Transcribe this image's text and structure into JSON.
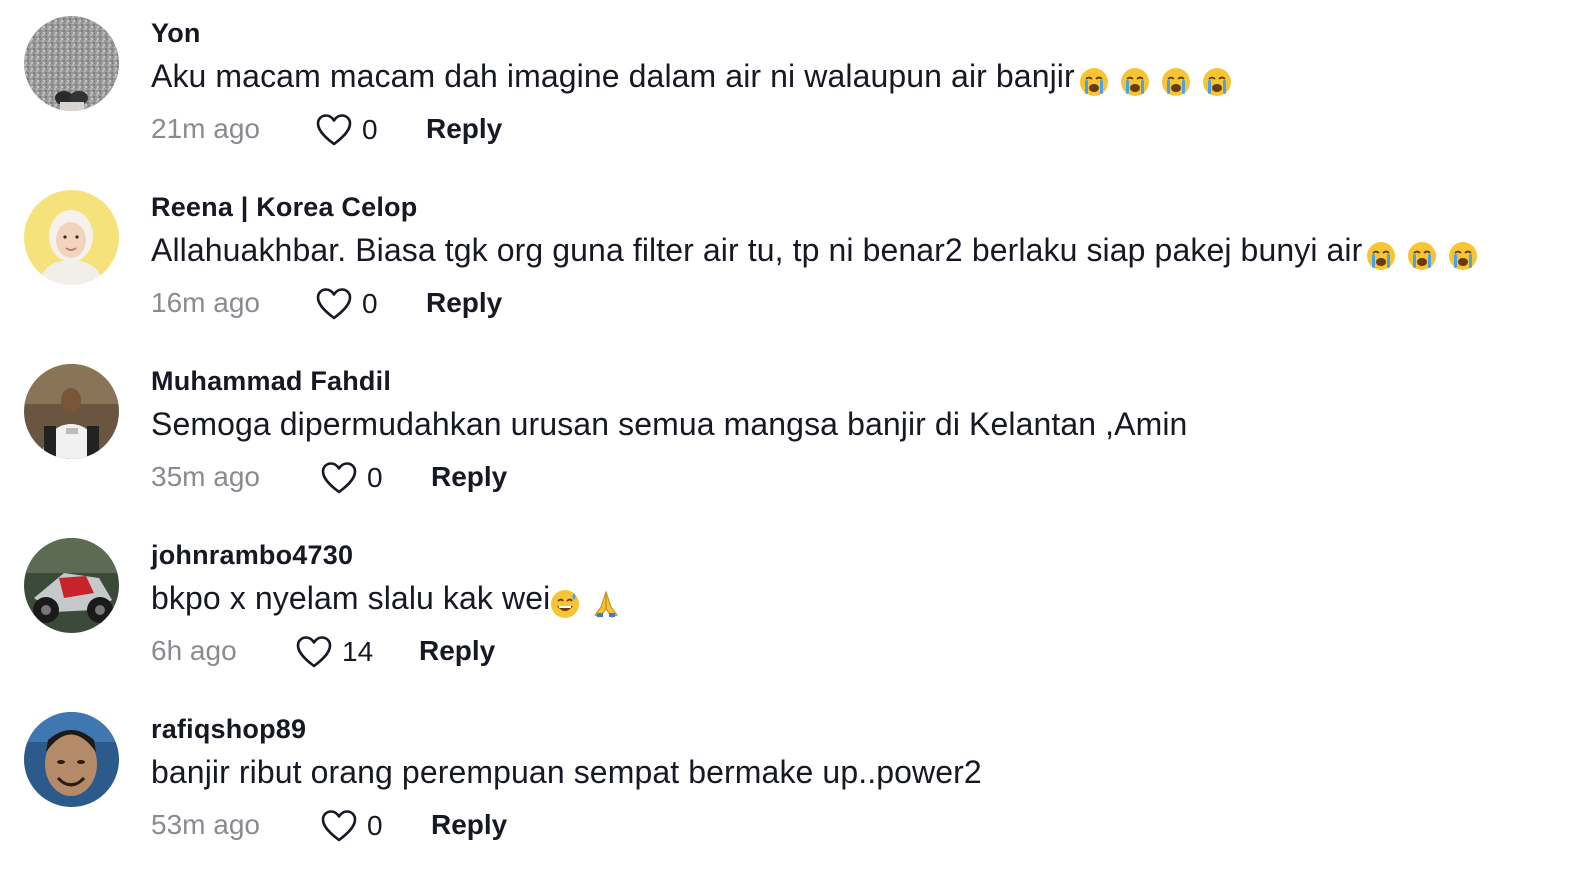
{
  "comments": [
    {
      "username": "Yon",
      "text": "Aku macam macam dah imagine dalam air ni walaupun air banjir",
      "emoji": [
        "loudly-crying-face",
        "loudly-crying-face",
        "loudly-crying-face",
        "loudly-crying-face"
      ],
      "time": "21m ago",
      "likes": "0",
      "reply_label": "Reply"
    },
    {
      "username": "Reena | Korea Celop",
      "text": "Allahuakhbar. Biasa tgk org guna filter air tu, tp ni benar2 berlaku siap pakej bunyi air",
      "emoji": [
        "loudly-crying-face",
        "loudly-crying-face",
        "loudly-crying-face"
      ],
      "time": "16m ago",
      "likes": "0",
      "reply_label": "Reply"
    },
    {
      "username": "Muhammad Fahdil",
      "text": "Semoga dipermudahkan urusan semua mangsa banjir di Kelantan ,Amin",
      "emoji": [],
      "time": "35m ago",
      "likes": "0",
      "reply_label": "Reply"
    },
    {
      "username": "johnrambo4730",
      "text": "bkpo x nyelam slalu kak wei",
      "emoji": [
        "grinning-sweat-face",
        "folded-hands"
      ],
      "time": "6h ago",
      "likes": "14",
      "reply_label": "Reply"
    },
    {
      "username": "rafiqshop89",
      "text": "banjir ribut orang perempuan sempat bermake up..power2",
      "emoji": [],
      "time": "53m ago",
      "likes": "0",
      "reply_label": "Reply"
    }
  ],
  "icons": {
    "like": "heart-outline-icon"
  },
  "colors": {
    "text": "#161823",
    "muted": "#8a8b91",
    "background": "#ffffff"
  }
}
